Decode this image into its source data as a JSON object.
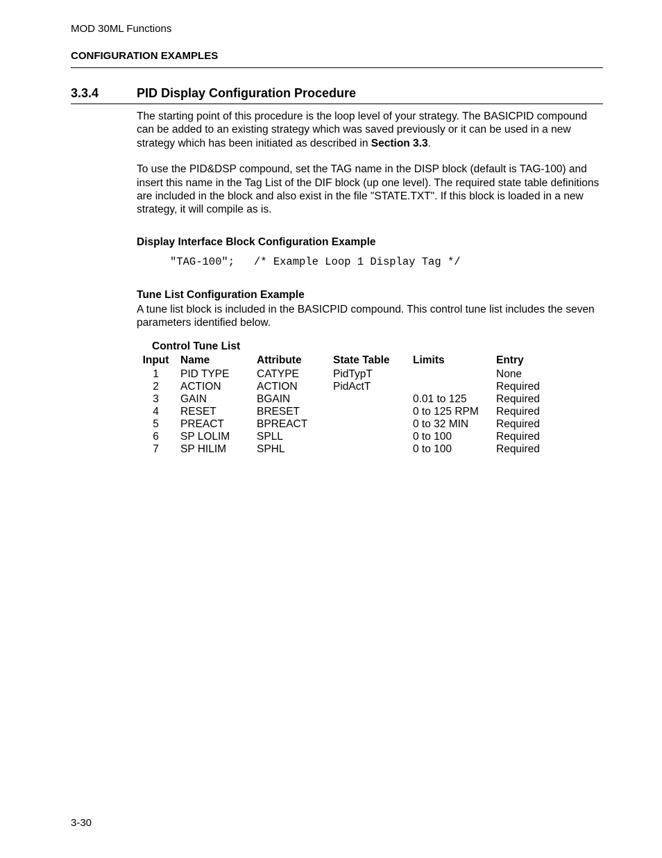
{
  "header": {
    "doc_title": "MOD 30ML Functions",
    "section_label": "CONFIGURATION EXAMPLES"
  },
  "section": {
    "number": "3.3.4",
    "title": "PID Display Configuration Procedure"
  },
  "para1_a": "The starting point of this procedure is the loop level of your strategy.  The BASICPID compound can be added to an existing strategy which was saved previously or it can be used in a new strategy which has been initiated as described in ",
  "para1_b": "Section 3.3",
  "para1_c": ".",
  "para2": "To use the PID&DSP compound, set the TAG name in the DISP block (default is TAG-100) and insert this name in the Tag List of the DIF block (up one level). The required state table definitions are included in the block and also exist in the file \"STATE.TXT\".  If this block is loaded in a new strategy, it will compile as is.",
  "display_interface": {
    "heading": "Display Interface Block Configuration Example",
    "code": "\"TAG-100\";   /* Example Loop 1 Display Tag */"
  },
  "tune_list": {
    "heading": "Tune List Configuration Example",
    "desc": "A tune list block is included in the BASICPID compound. This control tune list includes the seven parameters identified below.",
    "table_title": "Control Tune List",
    "headers": {
      "input": "Input",
      "name": "Name",
      "attribute": "Attribute",
      "state": "State Table",
      "limits": "Limits",
      "entry": "Entry"
    },
    "rows": [
      {
        "input": "1",
        "name": "PID TYPE",
        "attribute": "CATYPE",
        "state": "PidTypT",
        "limits": "",
        "entry": "None"
      },
      {
        "input": "2",
        "name": "ACTION",
        "attribute": "ACTION",
        "state": "PidActT",
        "limits": "",
        "entry": "Required"
      },
      {
        "input": "3",
        "name": "GAIN",
        "attribute": "BGAIN",
        "state": "",
        "limits": "0.01 to 125",
        "entry": "Required"
      },
      {
        "input": "4",
        "name": "RESET",
        "attribute": "BRESET",
        "state": "",
        "limits": "0 to 125 RPM",
        "entry": "Required"
      },
      {
        "input": "5",
        "name": "PREACT",
        "attribute": "BPREACT",
        "state": "",
        "limits": "0 to 32 MIN",
        "entry": "Required"
      },
      {
        "input": "6",
        "name": "SP LOLIM",
        "attribute": "SPLL",
        "state": "",
        "limits": "0 to 100",
        "entry": "Required"
      },
      {
        "input": "7",
        "name": "SP HILIM",
        "attribute": "SPHL",
        "state": "",
        "limits": "0 to 100",
        "entry": "Required"
      }
    ]
  },
  "page_number": "3-30"
}
